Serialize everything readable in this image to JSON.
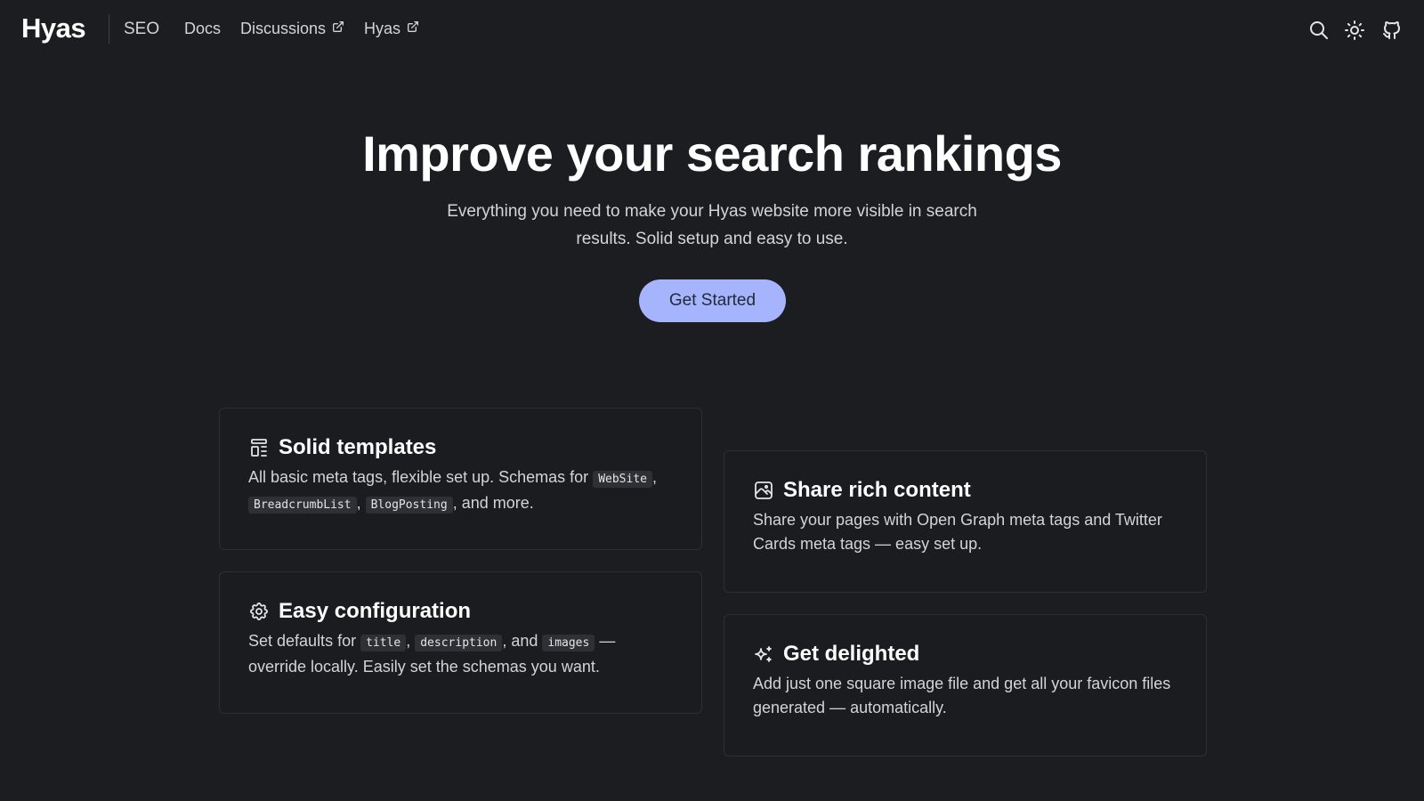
{
  "header": {
    "logo": "Hyas",
    "brand_sub": "SEO",
    "nav": {
      "docs": "Docs",
      "discussions": "Discussions",
      "hyas": "Hyas"
    },
    "icons": [
      "search-icon",
      "sun-icon",
      "github-icon"
    ]
  },
  "hero": {
    "title": "Improve your search rankings",
    "lead": "Everything you need to make your Hyas website more visible in search results. Solid setup and easy to use.",
    "cta": "Get Started"
  },
  "cards": {
    "solid_templates": {
      "title": "Solid templates",
      "icon": "layout-template-icon",
      "text_a": "All basic meta tags, flexible set up. Schemas for ",
      "code_1": "WebSite",
      "text_b": ", ",
      "code_2": "BreadcrumbList",
      "text_c": ", ",
      "code_3": "BlogPosting",
      "text_d": ", and more."
    },
    "share_rich": {
      "title": "Share rich content",
      "icon": "image-icon",
      "text": "Share your pages with Open Graph meta tags and Twitter Cards meta tags — easy set up."
    },
    "easy_config": {
      "title": "Easy configuration",
      "icon": "gear-icon",
      "text_a": "Set defaults for ",
      "code_1": "title",
      "text_b": ", ",
      "code_2": "description",
      "text_c": ", and ",
      "code_3": "images",
      "text_d": " — override locally. Easily set the schemas you want."
    },
    "delighted": {
      "title": "Get delighted",
      "icon": "sparkles-icon",
      "text": "Add just one square image file and get all your favicon files generated — automatically."
    }
  },
  "colors": {
    "background": "#1c1d21",
    "accent": "#a5b4fc",
    "card_border": "#2e2f35",
    "code_bg": "#2f3036"
  }
}
